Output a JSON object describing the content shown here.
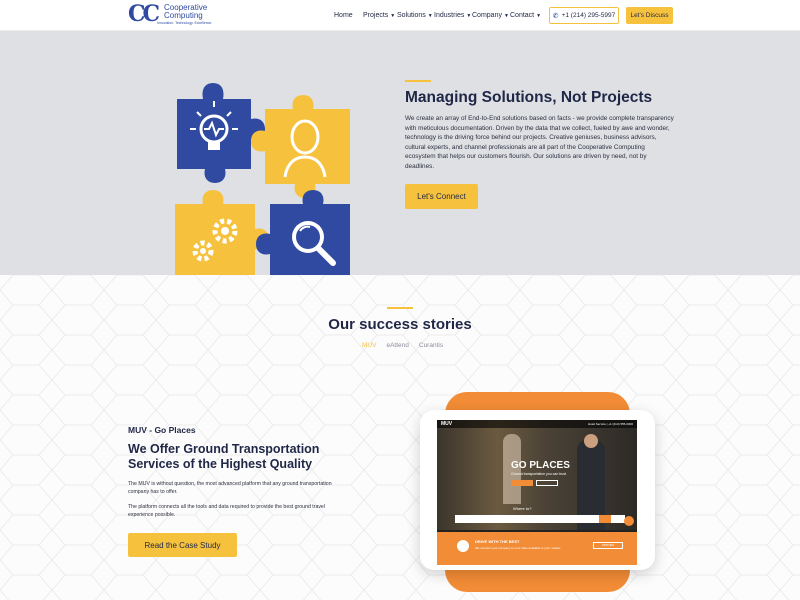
{
  "nav": {
    "logo_mark": "CC",
    "logo_line1": "Cooperative",
    "logo_line2": "Computing",
    "logo_tag": "Innovation. Technology. Excellence.",
    "items": [
      {
        "label": "Home",
        "has_dropdown": false
      },
      {
        "label": "Projects",
        "has_dropdown": true
      },
      {
        "label": "Solutions",
        "has_dropdown": true
      },
      {
        "label": "Industries",
        "has_dropdown": true
      },
      {
        "label": "Company",
        "has_dropdown": true
      },
      {
        "label": "Contact",
        "has_dropdown": true
      }
    ],
    "phone": "+1 (214) 295-5997",
    "phone_icon": "phone-icon",
    "cta": "Let's Discuss"
  },
  "hero": {
    "title": "Managing Solutions, Not Projects",
    "body": "We create an array of End-to-End solutions based on facts - we provide complete transparency with meticulous documentation. Driven by the data that we collect, fueled by awe and wonder, technology is the driving force behind our projects. Creative geniuses, business advisors, cultural experts, and channel professionals are all part of the Cooperative Computing ecosystem that helps our customers flourish. Our solutions are driven by need, not by deadlines.",
    "button": "Let's Connect",
    "illustration_icons": [
      "lightbulb-icon",
      "person-icon",
      "gears-icon",
      "magnifier-icon"
    ]
  },
  "success": {
    "title": "Our success stories",
    "tabs": [
      {
        "label": "MUV",
        "active": true
      },
      {
        "label": "eAttend",
        "active": false
      },
      {
        "label": "Curantis",
        "active": false
      }
    ],
    "case": {
      "kicker": "MUV - Go Places",
      "title": "We Offer Ground Transportation Services of the Highest Quality",
      "p1": "The MUV is without question, the most advanced platform that any ground transportation company has to offer.",
      "p2": "The platform connects all the tools and data required to provide the best ground travel experience possible.",
      "button": "Read the Case Study"
    },
    "mockup": {
      "brand": "MUV",
      "meta": "Hotel Service | +1 (214) 555-0000",
      "headline": "GO PLACES",
      "sub": "Ground transportation you can trust",
      "where": "Where to?",
      "drive_title": "DRIVE WITH THE BEST",
      "drive_sub": "We connect your company to mov rides available in your market.",
      "drive_btn": "PARTNER"
    }
  },
  "colors": {
    "accent": "#f6c23e",
    "navy": "#1f2746",
    "brand_blue": "#2f4aa0",
    "hero_bg": "#dfe0e4",
    "orange": "#f28c36"
  }
}
